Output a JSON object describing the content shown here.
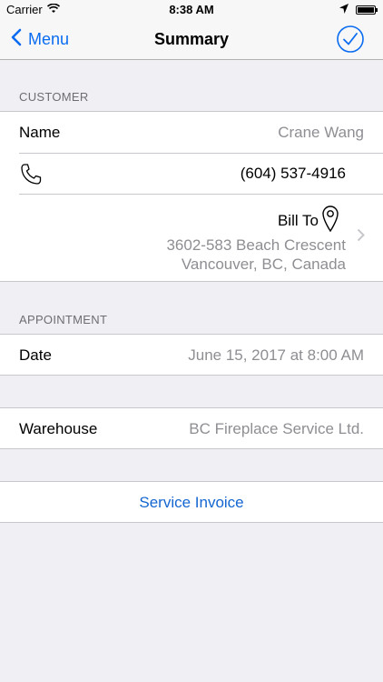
{
  "status": {
    "carrier": "Carrier",
    "time": "8:38 AM"
  },
  "nav": {
    "back_label": "Menu",
    "title": "Summary"
  },
  "customer": {
    "header": "CUSTOMER",
    "name_label": "Name",
    "name_value": "Crane Wang",
    "phone": "(604) 537-4916",
    "bill_to_label": "Bill To",
    "address_line1": "3602-583 Beach Crescent",
    "address_line2": "Vancouver, BC, Canada"
  },
  "appointment": {
    "header": "APPOINTMENT",
    "date_label": "Date",
    "date_value": "June 15, 2017 at 8:00 AM"
  },
  "warehouse": {
    "label": "Warehouse",
    "value": "BC Fireplace Service Ltd."
  },
  "service_invoice": {
    "label": "Service Invoice"
  },
  "colors": {
    "accent": "#0a6cf0",
    "link": "#1466d0",
    "background": "#efeff4",
    "secondary_text": "#8e8e93"
  },
  "icons": [
    "wifi-icon",
    "location-arrow-icon",
    "battery-icon",
    "chevron-left-icon",
    "checkmark-circle-icon",
    "phone-icon",
    "map-pin-icon",
    "chevron-right-icon"
  ]
}
